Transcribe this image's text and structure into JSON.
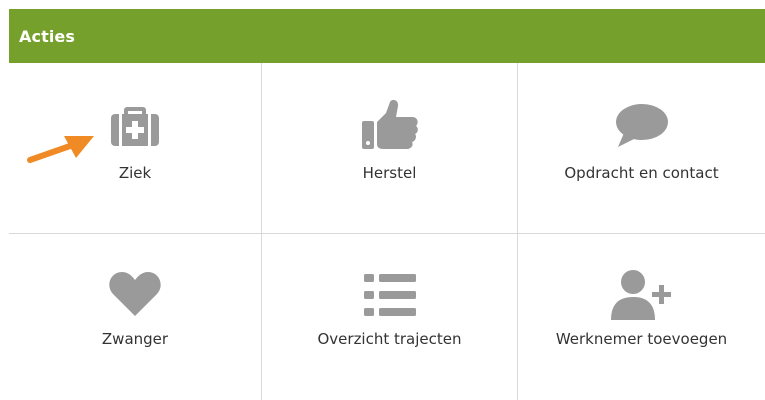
{
  "panel": {
    "title": "Acties",
    "header_color": "#76a02c",
    "icon_color": "#9a9a9a",
    "pointer_color": "#f08a24"
  },
  "actions": [
    {
      "label": "Ziek",
      "icon": "first-aid-kit-icon"
    },
    {
      "label": "Herstel",
      "icon": "thumbs-up-icon"
    },
    {
      "label": "Opdracht en contact",
      "icon": "speech-bubble-icon"
    },
    {
      "label": "Zwanger",
      "icon": "heart-icon"
    },
    {
      "label": "Overzicht trajecten",
      "icon": "list-icon"
    },
    {
      "label": "Werknemer toevoegen",
      "icon": "add-user-icon"
    }
  ]
}
